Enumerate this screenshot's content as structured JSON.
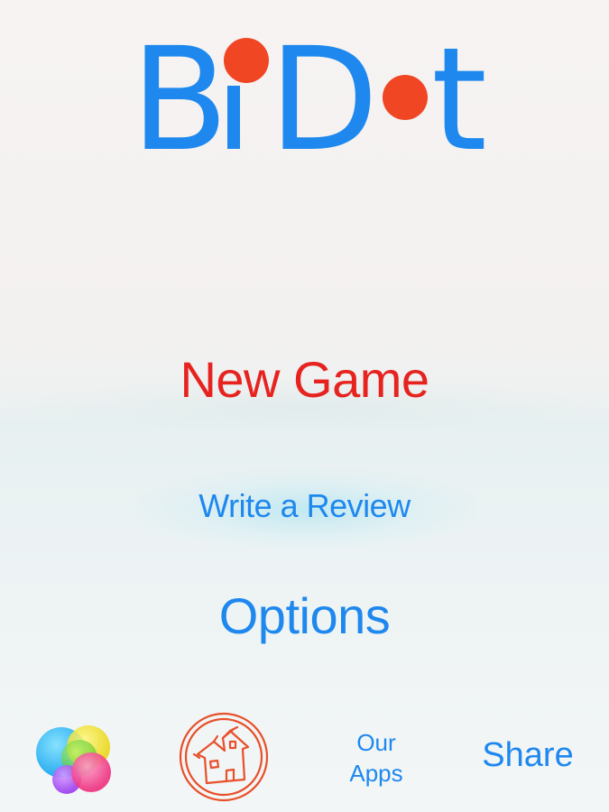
{
  "logo": {
    "text": "BiDot",
    "letters": [
      "B",
      "i",
      "D",
      "t"
    ],
    "colors": {
      "letters": "#1e88ee",
      "dots": "#f04623"
    }
  },
  "menu": {
    "new_game": "New Game",
    "write_review": "Write a Review",
    "options": "Options"
  },
  "bottom": {
    "game_center_icon": "game-center-bubbles-icon",
    "developer_icon": "haunted-house-icon",
    "our_apps_line1": "Our",
    "our_apps_line2": "Apps",
    "share": "Share"
  },
  "colors": {
    "accent_blue": "#1e88ee",
    "accent_red": "#e6231f"
  }
}
